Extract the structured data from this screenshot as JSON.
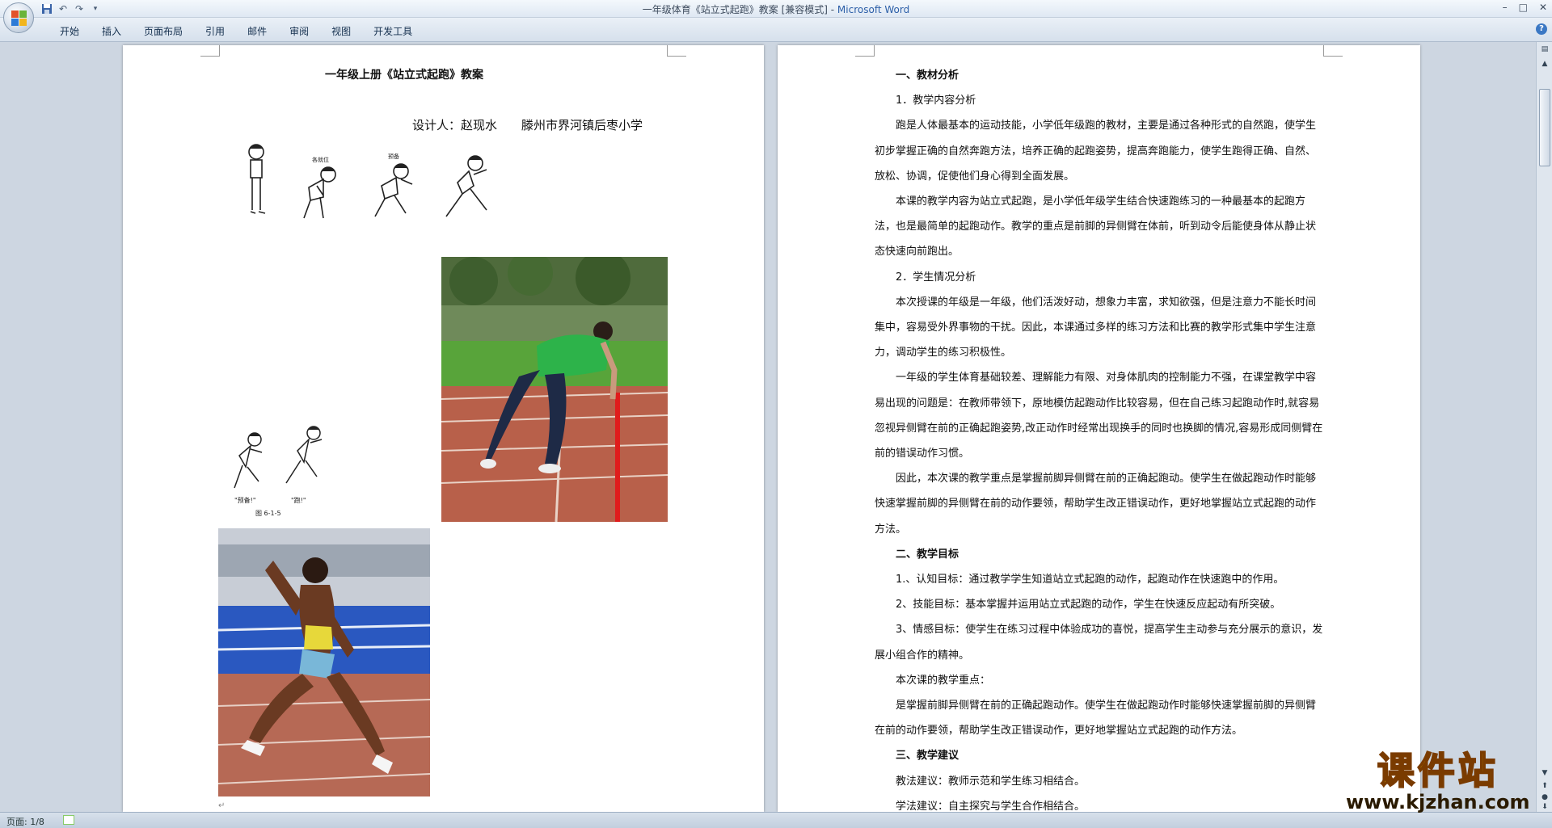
{
  "window": {
    "title_doc": "一年级体育《站立式起跑》教案 [兼容模式] - ",
    "title_app": "Microsoft Word"
  },
  "quick_access": {
    "icons": [
      "save-icon",
      "undo-icon",
      "redo-icon",
      "customize-icon"
    ]
  },
  "menu": {
    "tabs": [
      "开始",
      "插入",
      "页面布局",
      "引用",
      "邮件",
      "审阅",
      "视图",
      "开发工具"
    ]
  },
  "left_page": {
    "title": "一年级上册《站立式起跑》教案",
    "designer": "设计人：赵现水　　滕州市界河镇后枣小学",
    "figure_labels": {
      "ready_top": "各就位",
      "set_top": "预备",
      "ready_bottom": "\"预备!\"",
      "go_bottom": "\"跑!\"",
      "caption": "图 6-1-5"
    }
  },
  "right_page": {
    "paragraphs": [
      {
        "type": "h",
        "text": "一、教材分析"
      },
      {
        "type": "sub",
        "text": "1．教学内容分析"
      },
      {
        "type": "p",
        "text": "跑是人体最基本的运动技能，小学低年级跑的教材，主要是通过各种形式的自然跑，使学生初步掌握正确的自然奔跑方法，培养正确的起跑姿势，提高奔跑能力，使学生跑得正确、自然、放松、协调，促使他们身心得到全面发展。"
      },
      {
        "type": "p",
        "text": "本课的教学内容为站立式起跑，是小学低年级学生结合快速跑练习的一种最基本的起跑方法，也是最简单的起跑动作。教学的重点是前脚的异侧臂在体前，听到动令后能使身体从静止状态快速向前跑出。"
      },
      {
        "type": "sub",
        "text": "2．学生情况分析"
      },
      {
        "type": "p",
        "text": "本次授课的年级是一年级，他们活泼好动，想象力丰富，求知欲强，但是注意力不能长时间集中，容易受外界事物的干扰。因此，本课通过多样的练习方法和比赛的教学形式集中学生注意力，调动学生的练习积极性。"
      },
      {
        "type": "p",
        "text": "一年级的学生体育基础较差、理解能力有限、对身体肌肉的控制能力不强，在课堂教学中容易出现的问题是：在教师带领下，原地模仿起跑动作比较容易，但在自己练习起跑动作时,就容易忽视异侧臂在前的正确起跑姿势,改正动作时经常出现换手的同时也换脚的情况,容易形成同侧臂在前的错误动作习惯。"
      },
      {
        "type": "p",
        "text": "因此，本次课的教学重点是掌握前脚异侧臂在前的正确起跑动。使学生在做起跑动作时能够快速掌握前脚的异侧臂在前的动作要领，帮助学生改正错误动作，更好地掌握站立式起跑的动作方法。"
      },
      {
        "type": "h",
        "text": "二、教学目标"
      },
      {
        "type": "sub",
        "text": "1.、认知目标：通过教学学生知道站立式起跑的动作，起跑动作在快速跑中的作用。"
      },
      {
        "type": "sub",
        "text": "2、技能目标：基本掌握并运用站立式起跑的动作，学生在快速反应起动有所突破。"
      },
      {
        "type": "p",
        "text": "3、情感目标：使学生在练习过程中体验成功的喜悦，提高学生主动参与充分展示的意识，发展小组合作的精神。"
      },
      {
        "type": "sub",
        "text": "本次课的教学重点："
      },
      {
        "type": "p",
        "text": "是掌握前脚异侧臂在前的正确起跑动作。使学生在做起跑动作时能够快速掌握前脚的异侧臂在前的动作要领，帮助学生改正错误动作，更好地掌握站立式起跑的动作方法。"
      },
      {
        "type": "h",
        "text": "三、教学建议"
      },
      {
        "type": "sub",
        "text": "教法建议：教师示范和学生练习相结合。"
      },
      {
        "type": "sub",
        "text": "学法建议：自主探究与学生合作相结合。"
      }
    ]
  },
  "status": {
    "page": "页面: 1/8"
  },
  "watermark": {
    "big": "课件站",
    "small": "www.kjzhan.com"
  },
  "colors": {
    "accent": "#2c5fa8",
    "track": "#b8604a",
    "grass": "#4e9a2e",
    "jersey": "#2db34a"
  }
}
